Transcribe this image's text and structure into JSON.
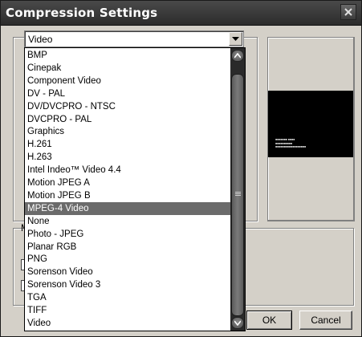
{
  "window": {
    "title": "Compression Settings"
  },
  "combo": {
    "selected": "Video"
  },
  "dropdown": {
    "items": [
      "BMP",
      "Cinepak",
      "Component Video",
      "DV - PAL",
      "DV/DVCPRO - NTSC",
      "DVCPRO - PAL",
      "Graphics",
      "H.261",
      "H.263",
      "Intel Indeo™ Video 4.4",
      "Motion JPEG A",
      "Motion JPEG B",
      "MPEG-4 Video",
      "None",
      "Photo - JPEG",
      "Planar RGB",
      "PNG",
      "Sorenson Video",
      "Sorenson Video 3",
      "TGA",
      "TIFF",
      "Video"
    ],
    "selected_index": 12
  },
  "background": {
    "motion_label": "M"
  },
  "buttons": {
    "ok": "OK",
    "cancel": "Cancel"
  },
  "icons": {
    "close": "close-icon",
    "combo_arrow": "chevron-down-icon",
    "scroll_up": "scroll-up-arrow-icon",
    "scroll_down": "scroll-down-arrow-icon"
  }
}
